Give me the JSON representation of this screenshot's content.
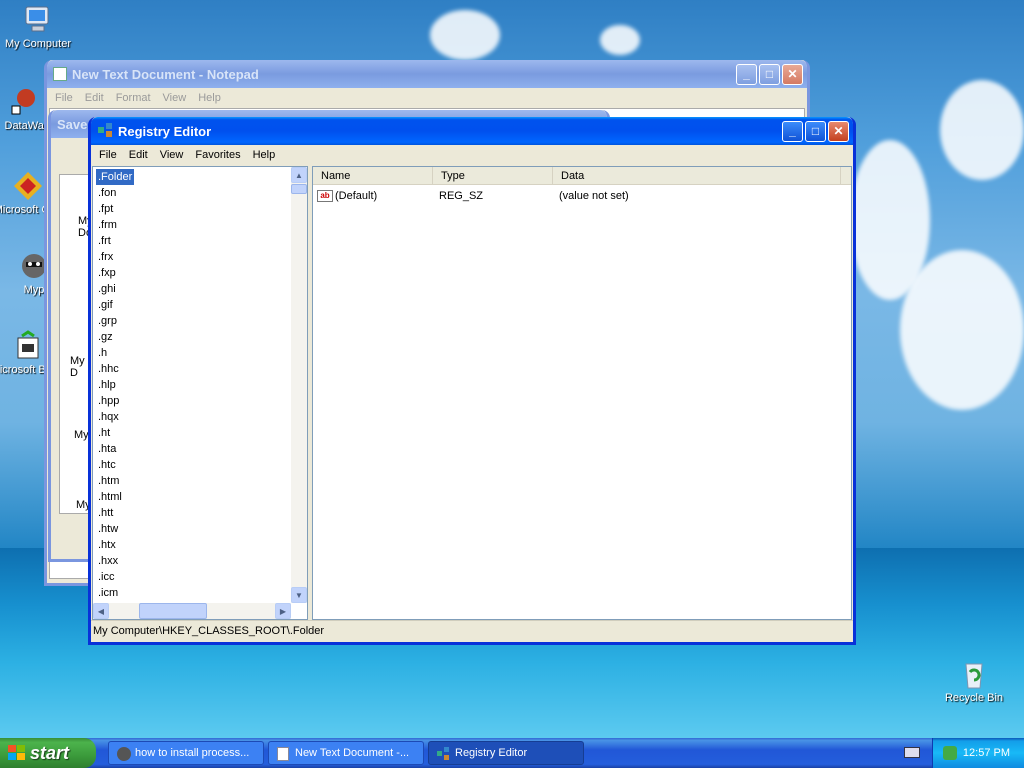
{
  "desktop": {
    "icons": [
      {
        "label": "My Computer"
      },
      {
        "label": "DataWar"
      },
      {
        "label": "Microsoft C++"
      },
      {
        "label": "Myp"
      },
      {
        "label": "Microsoft Basic"
      },
      {
        "label": "Recycle Bin"
      }
    ]
  },
  "notepad": {
    "title": "New Text Document - Notepad",
    "menu": [
      "File",
      "Edit",
      "Format",
      "View",
      "Help"
    ]
  },
  "save_dialog": {
    "title": "Save",
    "side_labels": [
      "My Do",
      "D",
      "My D",
      "My",
      "My"
    ]
  },
  "regedit": {
    "title": "Registry Editor",
    "menu": [
      "File",
      "Edit",
      "View",
      "Favorites",
      "Help"
    ],
    "tree": [
      ".Folder",
      ".fon",
      ".fpt",
      ".frm",
      ".frt",
      ".frx",
      ".fxp",
      ".ghi",
      ".gif",
      ".grp",
      ".gz",
      ".h",
      ".hhc",
      ".hlp",
      ".hpp",
      ".hqx",
      ".ht",
      ".hta",
      ".htc",
      ".htm",
      ".html",
      ".htt",
      ".htw",
      ".htx",
      ".hxx",
      ".icc",
      ".icm"
    ],
    "columns": [
      "Name",
      "Type",
      "Data"
    ],
    "rows": [
      {
        "name": "(Default)",
        "type": "REG_SZ",
        "data": "(value not set)"
      }
    ],
    "status": "My Computer\\HKEY_CLASSES_ROOT\\.Folder"
  },
  "taskbar": {
    "start_label": "start",
    "tasks": [
      {
        "label": "how to install process..."
      },
      {
        "label": "New Text Document -..."
      },
      {
        "label": "Registry Editor"
      }
    ],
    "clock": "12:57 PM"
  },
  "colors": {
    "xp_blue": "#0831d9",
    "selection": "#316ac5",
    "start_green": "#3b9a3b"
  }
}
